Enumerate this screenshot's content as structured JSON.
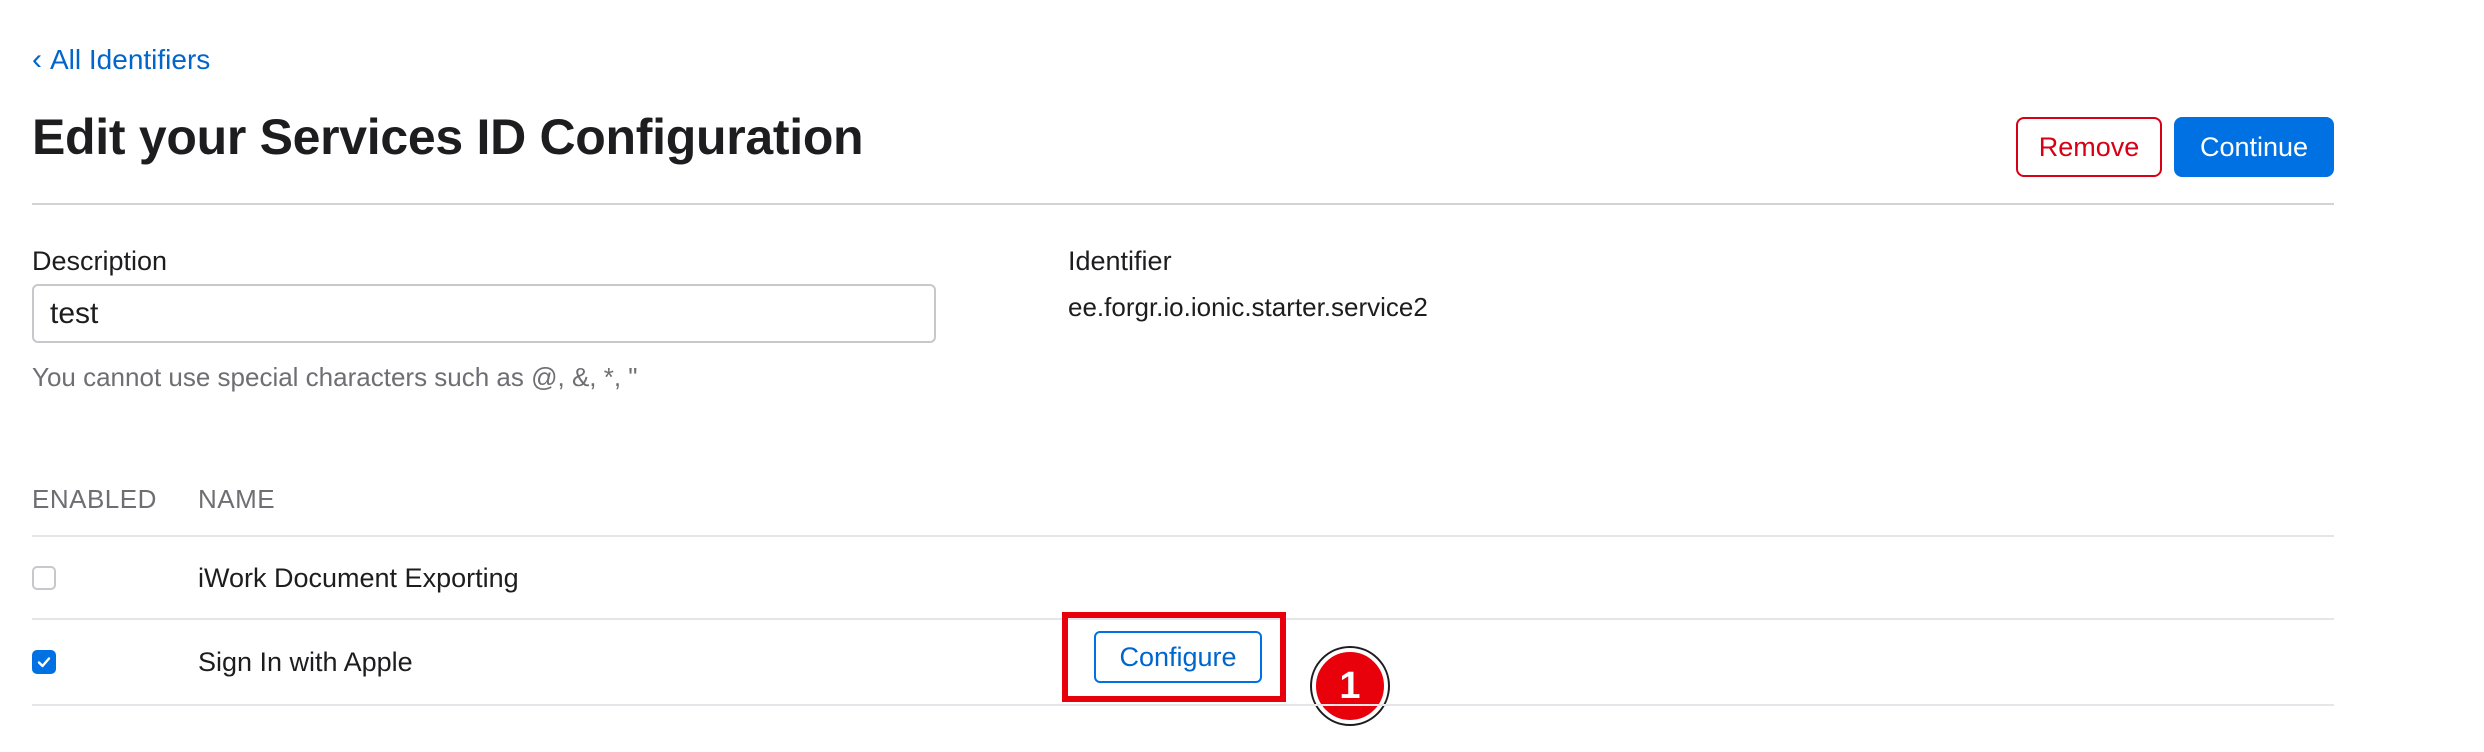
{
  "nav": {
    "back_chevron": "‹",
    "back_label": "All Identifiers"
  },
  "header": {
    "title": "Edit your Services ID Configuration",
    "remove_label": "Remove",
    "continue_label": "Continue"
  },
  "form": {
    "description_label": "Description",
    "description_value": "test",
    "description_hint": "You cannot use special characters such as @, &, *, \"",
    "identifier_label": "Identifier",
    "identifier_value": "ee.forgr.io.ionic.starter.service2"
  },
  "capabilities": {
    "columns": [
      "ENABLED",
      "NAME"
    ],
    "rows": [
      {
        "name": "iWork Document Exporting",
        "enabled": false
      },
      {
        "name": "Sign In with Apple",
        "enabled": true,
        "action_label": "Configure"
      }
    ]
  },
  "annotation": {
    "step_number": "1",
    "highlight_color": "#e8000b"
  },
  "colors": {
    "link": "#0066cc",
    "primary": "#0071e3",
    "danger": "#d70015"
  }
}
